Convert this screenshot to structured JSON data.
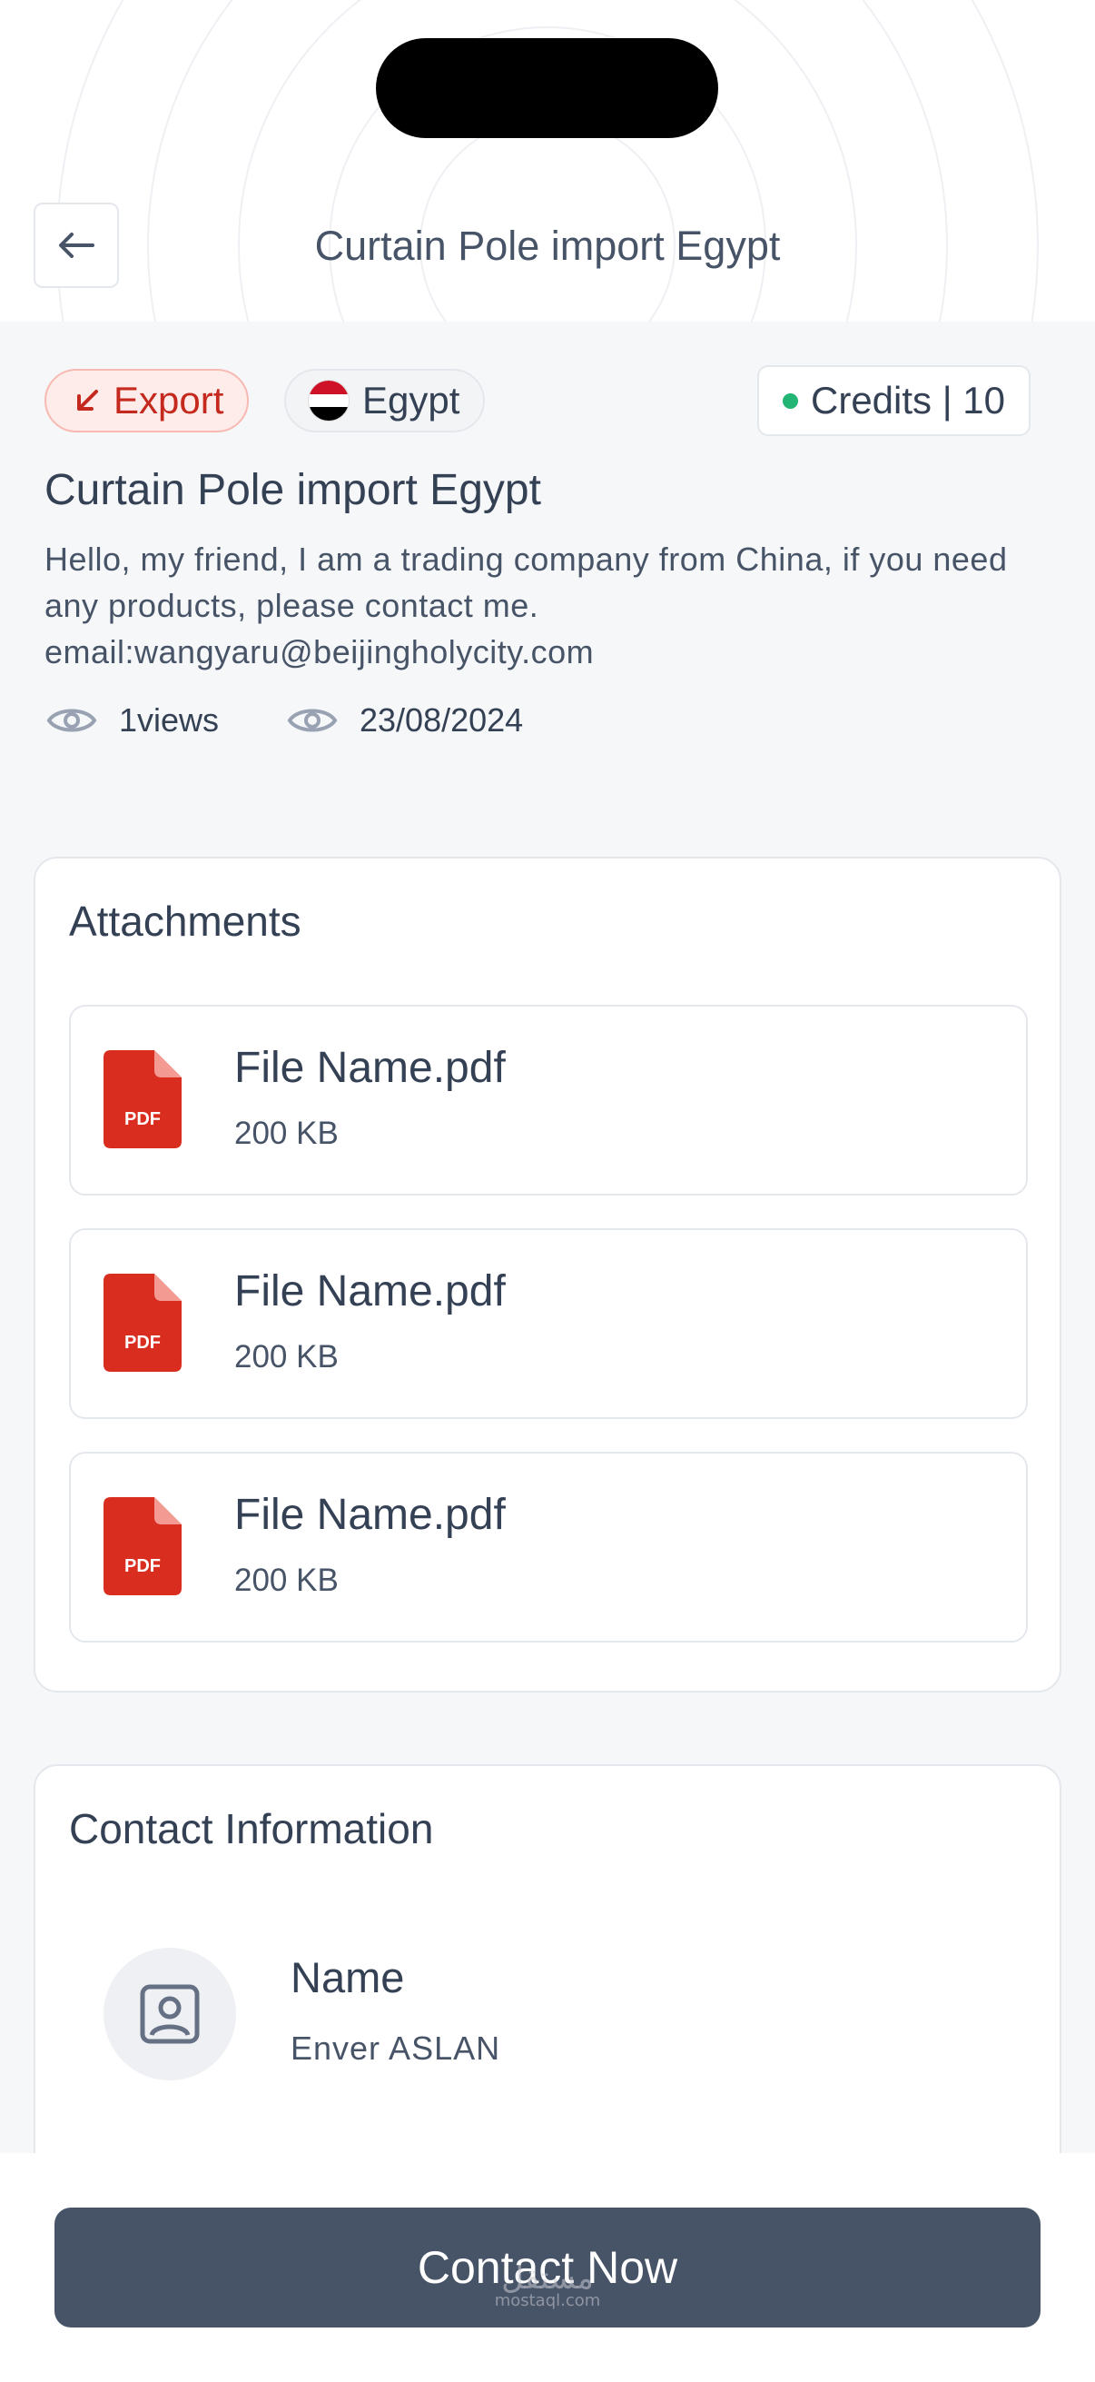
{
  "header": {
    "title": "Curtain Pole import Egypt",
    "back_icon": "arrow-left-icon"
  },
  "tags": {
    "type_label": "Export",
    "type_color": "#c5291d",
    "country_label": "Egypt",
    "credits_label": "Credits | 10",
    "credits_status_color": "#22b573"
  },
  "post": {
    "title": "Curtain Pole import Egypt",
    "description": "Hello, my friend, I am a trading company from China, if you need any products, please contact me. email:wangyaru@beijingholycity.com",
    "views": "1views",
    "date": "23/08/2024"
  },
  "attachments": {
    "title": "Attachments",
    "files": [
      {
        "name": "File Name.pdf",
        "size": "200 KB",
        "icon": "pdf-icon"
      },
      {
        "name": "File Name.pdf",
        "size": "200 KB",
        "icon": "pdf-icon"
      },
      {
        "name": "File Name.pdf",
        "size": "200 KB",
        "icon": "pdf-icon"
      }
    ]
  },
  "contact": {
    "title": "Contact Information",
    "name_label": "Name",
    "name_value": "Enver ASLAN",
    "icon": "contact-card-icon"
  },
  "footer": {
    "button_label": "Contact Now",
    "button_color": "#475467",
    "watermark": "مستقل",
    "watermark_sub": "mostaql.com"
  }
}
